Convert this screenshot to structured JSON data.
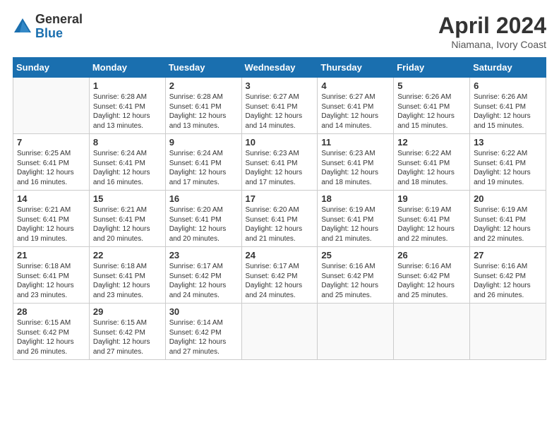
{
  "logo": {
    "general": "General",
    "blue": "Blue"
  },
  "title": {
    "month": "April 2024",
    "location": "Niamana, Ivory Coast"
  },
  "days_of_week": [
    "Sunday",
    "Monday",
    "Tuesday",
    "Wednesday",
    "Thursday",
    "Friday",
    "Saturday"
  ],
  "weeks": [
    [
      {
        "day": "",
        "empty": true
      },
      {
        "day": "1",
        "sunrise": "6:28 AM",
        "sunset": "6:41 PM",
        "daylight": "12 hours and 13 minutes."
      },
      {
        "day": "2",
        "sunrise": "6:28 AM",
        "sunset": "6:41 PM",
        "daylight": "12 hours and 13 minutes."
      },
      {
        "day": "3",
        "sunrise": "6:27 AM",
        "sunset": "6:41 PM",
        "daylight": "12 hours and 14 minutes."
      },
      {
        "day": "4",
        "sunrise": "6:27 AM",
        "sunset": "6:41 PM",
        "daylight": "12 hours and 14 minutes."
      },
      {
        "day": "5",
        "sunrise": "6:26 AM",
        "sunset": "6:41 PM",
        "daylight": "12 hours and 15 minutes."
      },
      {
        "day": "6",
        "sunrise": "6:26 AM",
        "sunset": "6:41 PM",
        "daylight": "12 hours and 15 minutes."
      }
    ],
    [
      {
        "day": "7",
        "sunrise": "6:25 AM",
        "sunset": "6:41 PM",
        "daylight": "12 hours and 16 minutes."
      },
      {
        "day": "8",
        "sunrise": "6:24 AM",
        "sunset": "6:41 PM",
        "daylight": "12 hours and 16 minutes."
      },
      {
        "day": "9",
        "sunrise": "6:24 AM",
        "sunset": "6:41 PM",
        "daylight": "12 hours and 17 minutes."
      },
      {
        "day": "10",
        "sunrise": "6:23 AM",
        "sunset": "6:41 PM",
        "daylight": "12 hours and 17 minutes."
      },
      {
        "day": "11",
        "sunrise": "6:23 AM",
        "sunset": "6:41 PM",
        "daylight": "12 hours and 18 minutes."
      },
      {
        "day": "12",
        "sunrise": "6:22 AM",
        "sunset": "6:41 PM",
        "daylight": "12 hours and 18 minutes."
      },
      {
        "day": "13",
        "sunrise": "6:22 AM",
        "sunset": "6:41 PM",
        "daylight": "12 hours and 19 minutes."
      }
    ],
    [
      {
        "day": "14",
        "sunrise": "6:21 AM",
        "sunset": "6:41 PM",
        "daylight": "12 hours and 19 minutes."
      },
      {
        "day": "15",
        "sunrise": "6:21 AM",
        "sunset": "6:41 PM",
        "daylight": "12 hours and 20 minutes."
      },
      {
        "day": "16",
        "sunrise": "6:20 AM",
        "sunset": "6:41 PM",
        "daylight": "12 hours and 20 minutes."
      },
      {
        "day": "17",
        "sunrise": "6:20 AM",
        "sunset": "6:41 PM",
        "daylight": "12 hours and 21 minutes."
      },
      {
        "day": "18",
        "sunrise": "6:19 AM",
        "sunset": "6:41 PM",
        "daylight": "12 hours and 21 minutes."
      },
      {
        "day": "19",
        "sunrise": "6:19 AM",
        "sunset": "6:41 PM",
        "daylight": "12 hours and 22 minutes."
      },
      {
        "day": "20",
        "sunrise": "6:19 AM",
        "sunset": "6:41 PM",
        "daylight": "12 hours and 22 minutes."
      }
    ],
    [
      {
        "day": "21",
        "sunrise": "6:18 AM",
        "sunset": "6:41 PM",
        "daylight": "12 hours and 23 minutes."
      },
      {
        "day": "22",
        "sunrise": "6:18 AM",
        "sunset": "6:41 PM",
        "daylight": "12 hours and 23 minutes."
      },
      {
        "day": "23",
        "sunrise": "6:17 AM",
        "sunset": "6:42 PM",
        "daylight": "12 hours and 24 minutes."
      },
      {
        "day": "24",
        "sunrise": "6:17 AM",
        "sunset": "6:42 PM",
        "daylight": "12 hours and 24 minutes."
      },
      {
        "day": "25",
        "sunrise": "6:16 AM",
        "sunset": "6:42 PM",
        "daylight": "12 hours and 25 minutes."
      },
      {
        "day": "26",
        "sunrise": "6:16 AM",
        "sunset": "6:42 PM",
        "daylight": "12 hours and 25 minutes."
      },
      {
        "day": "27",
        "sunrise": "6:16 AM",
        "sunset": "6:42 PM",
        "daylight": "12 hours and 26 minutes."
      }
    ],
    [
      {
        "day": "28",
        "sunrise": "6:15 AM",
        "sunset": "6:42 PM",
        "daylight": "12 hours and 26 minutes."
      },
      {
        "day": "29",
        "sunrise": "6:15 AM",
        "sunset": "6:42 PM",
        "daylight": "12 hours and 27 minutes."
      },
      {
        "day": "30",
        "sunrise": "6:14 AM",
        "sunset": "6:42 PM",
        "daylight": "12 hours and 27 minutes."
      },
      {
        "day": "",
        "empty": true
      },
      {
        "day": "",
        "empty": true
      },
      {
        "day": "",
        "empty": true
      },
      {
        "day": "",
        "empty": true
      }
    ]
  ]
}
